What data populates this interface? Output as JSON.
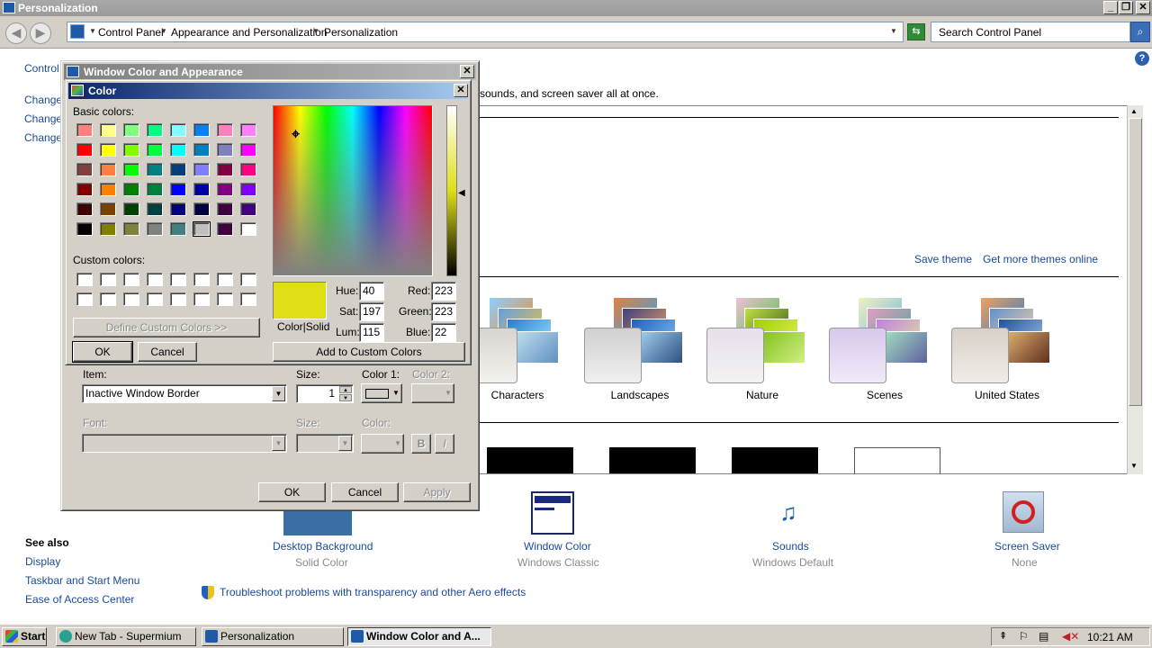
{
  "window": {
    "title": "Personalization"
  },
  "breadcrumbs": [
    "Control Panel",
    "Appearance and Personalization",
    "Personalization"
  ],
  "search": {
    "placeholder": "Search Control Panel"
  },
  "content": {
    "left_links": [
      "Control Panel Home",
      "Change desktop icons",
      "Change mouse pointers",
      "Change your account picture"
    ],
    "intro_fragment": "sounds, and screen saver all at once.",
    "save_theme": "Save theme",
    "get_more_themes": "Get more themes online",
    "themes": [
      "Characters",
      "Landscapes",
      "Nature",
      "Scenes",
      "United States"
    ],
    "settings": [
      {
        "label": "Desktop Background",
        "value": "Solid Color"
      },
      {
        "label": "Window Color",
        "value": "Windows Classic"
      },
      {
        "label": "Sounds",
        "value": "Windows Default"
      },
      {
        "label": "Screen Saver",
        "value": "None"
      }
    ],
    "see_also": {
      "title": "See also",
      "links": [
        "Display",
        "Taskbar and Start Menu",
        "Ease of Access Center"
      ]
    },
    "troubleshoot": "Troubleshoot problems with transparency and other Aero effects"
  },
  "wca_dialog": {
    "title": "Window Color and Appearance",
    "item_label": "Item:",
    "item_value": "Inactive Window Border",
    "size_label": "Size:",
    "size_value": "1",
    "color1_label": "Color 1:",
    "color2_label": "Color 2:",
    "font_label": "Font:",
    "font_size_label": "Size:",
    "font_color_label": "Color:",
    "bold": "B",
    "italic": "I",
    "ok": "OK",
    "cancel": "Cancel",
    "apply": "Apply"
  },
  "color_dialog": {
    "title": "Color",
    "basic_colors_label": "Basic colors:",
    "custom_colors_label": "Custom colors:",
    "define_custom": "Define Custom Colors >>",
    "ok": "OK",
    "cancel": "Cancel",
    "color_solid_label": "Color|Solid",
    "hue_label": "Hue:",
    "hue": "40",
    "sat_label": "Sat:",
    "sat": "197",
    "lum_label": "Lum:",
    "lum": "115",
    "red_label": "Red:",
    "red": "223",
    "green_label": "Green:",
    "green": "223",
    "blue_label": "Blue:",
    "blue": "22",
    "add_custom": "Add to Custom Colors",
    "current_color": "#dfdf16",
    "basic_palette": [
      "#ff8080",
      "#ffff80",
      "#80ff80",
      "#00ff80",
      "#80ffff",
      "#0080ff",
      "#ff80c0",
      "#ff80ff",
      "#ff0000",
      "#ffff00",
      "#80ff00",
      "#00ff40",
      "#00ffff",
      "#0080c0",
      "#8080c0",
      "#ff00ff",
      "#804040",
      "#ff8040",
      "#00ff00",
      "#008080",
      "#004080",
      "#8080ff",
      "#800040",
      "#ff0080",
      "#800000",
      "#ff8000",
      "#008000",
      "#008040",
      "#0000ff",
      "#0000a0",
      "#800080",
      "#8000ff",
      "#400000",
      "#804000",
      "#004000",
      "#004040",
      "#000080",
      "#000040",
      "#400040",
      "#400080",
      "#000000",
      "#808000",
      "#808040",
      "#808080",
      "#408080",
      "#c0c0c0",
      "#400040",
      "#ffffff"
    ]
  },
  "taskbar": {
    "start": "Start",
    "items": [
      "New Tab - Supermium",
      "Personalization",
      "Window Color and A..."
    ],
    "clock": "10:21 AM"
  }
}
